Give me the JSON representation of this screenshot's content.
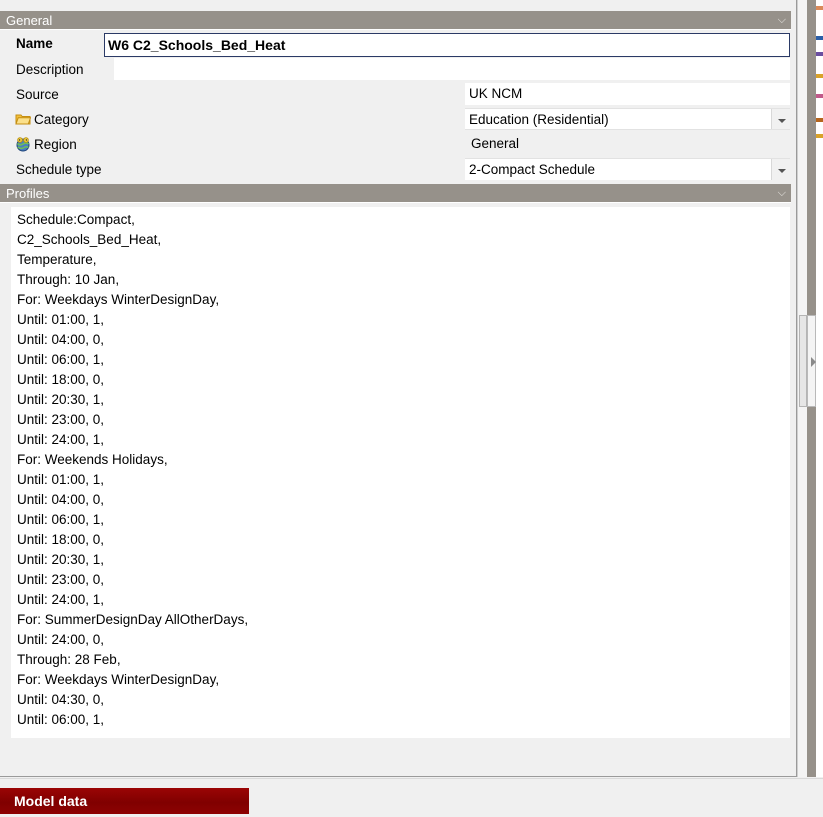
{
  "sections": {
    "general": {
      "title": "General",
      "collapse_icon": "double-chevron-down-icon"
    },
    "profiles": {
      "title": "Profiles",
      "collapse_icon": "double-chevron-down-icon"
    }
  },
  "general_fields": {
    "name": {
      "label": "Name",
      "value": "W6 C2_Schools_Bed_Heat",
      "placeholder": ""
    },
    "description": {
      "label": "Description",
      "value": "",
      "placeholder": ""
    },
    "source": {
      "label": "Source",
      "value": "UK NCM"
    },
    "category": {
      "label": "Category",
      "value": "Education (Residential)",
      "icon": "folder-icon"
    },
    "region": {
      "label": "Region",
      "value": "General",
      "icon": "globe-icon"
    },
    "schedule_type": {
      "label": "Schedule type",
      "value": "2-Compact Schedule"
    }
  },
  "profiles": {
    "lines": [
      "Schedule:Compact,",
      "C2_Schools_Bed_Heat,",
      "Temperature,",
      "Through: 10 Jan,",
      "For: Weekdays WinterDesignDay,",
      "Until: 01:00, 1,",
      "Until: 04:00, 0,",
      "Until: 06:00, 1,",
      "Until: 18:00, 0,",
      "Until: 20:30, 1,",
      "Until: 23:00, 0,",
      "Until: 24:00, 1,",
      "For: Weekends Holidays,",
      "Until: 01:00, 1,",
      "Until: 04:00, 0,",
      "Until: 06:00, 1,",
      "Until: 18:00, 0,",
      "Until: 20:30, 1,",
      "Until: 23:00, 0,",
      "Until: 24:00, 1,",
      "For: SummerDesignDay AllOtherDays,",
      "Until: 24:00, 0,",
      "Through: 28 Feb,",
      "For: Weekdays WinterDesignDay,",
      "Until: 04:30, 0,",
      "Until: 06:00, 1,"
    ]
  },
  "bottom_bar": {
    "model_data_label": "Model data"
  },
  "colors": {
    "section_header": "#96918a",
    "model_data_bar": "#8b0000",
    "focused_field_border": "#2b3a66",
    "panel_background": "#f0f0f0"
  }
}
